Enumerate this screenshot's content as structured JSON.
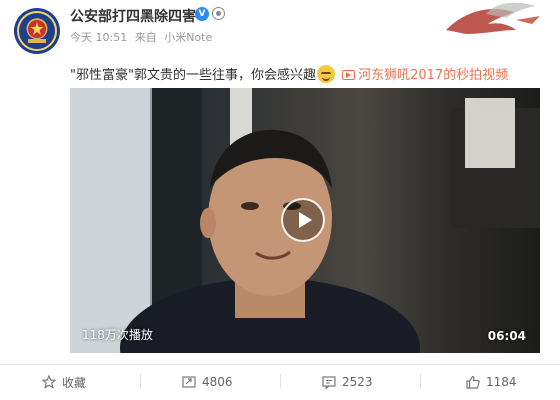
{
  "post": {
    "username": "公安部打四黑除四害",
    "verified_badge": "V",
    "time": "今天 10:51",
    "source_prefix": "来自",
    "source": "小米Note",
    "text": "\"邪性富豪\"郭文贵的一些往事，你会感兴趣",
    "video_link": "河东狮吼2017的秒拍视频"
  },
  "video": {
    "views": "118万次播放",
    "duration": "06:04"
  },
  "actions": {
    "favorite": "收藏",
    "repost": "4806",
    "comment": "2523",
    "like": "1184"
  },
  "colors": {
    "link": "#eb7350",
    "verified": "#2b8cf0",
    "text": "#333333",
    "meta": "#999999"
  },
  "icons": [
    "police-emblem-avatar",
    "verified-icon",
    "phoenix-decoration",
    "smile-emoji",
    "video-icon",
    "play-icon",
    "star-icon",
    "repost-icon",
    "comment-icon",
    "like-icon"
  ]
}
